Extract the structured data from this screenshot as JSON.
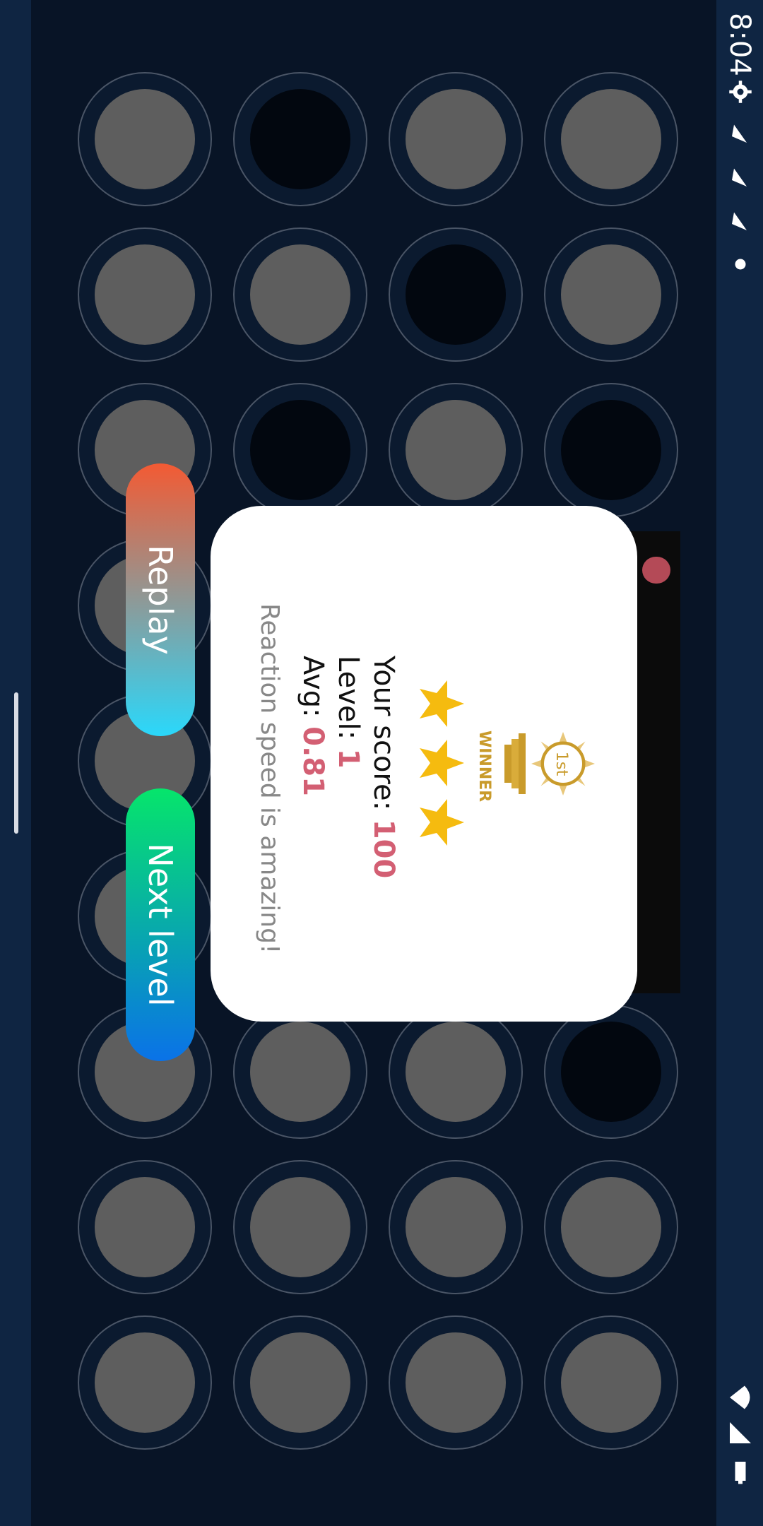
{
  "status": {
    "time": "8:04"
  },
  "dialog": {
    "winner_label": "WINNER",
    "medal_text": "1st",
    "stars": 3,
    "score_label": "Your score:",
    "score_value": "100",
    "level_label": "Level:",
    "level_value": "1",
    "avg_label": "Avg:",
    "avg_value": "0.81",
    "message": "Reaction speed is amazing!"
  },
  "buttons": {
    "replay": "Replay",
    "next_level": "Next level"
  },
  "grid": {
    "rows": 9,
    "cols": 4,
    "dark_cells": [
      [
        0,
        2
      ],
      [
        1,
        1
      ],
      [
        2,
        0
      ],
      [
        2,
        2
      ],
      [
        6,
        0
      ]
    ]
  },
  "colors": {
    "accent": "#d35f73",
    "background": "#081426"
  }
}
